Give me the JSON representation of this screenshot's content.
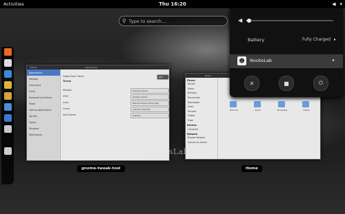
{
  "topbar": {
    "activities": "Activities",
    "clock": "Thu 16:20",
    "indicator_icons": [
      "volume-icon",
      "user-menu-chevron"
    ]
  },
  "search": {
    "placeholder": "Type to search..."
  },
  "dash": {
    "apps": [
      {
        "name": "firefox-icon",
        "color": "#e66a1f"
      },
      {
        "name": "mail-icon",
        "color": "#dddddd"
      },
      {
        "name": "internet-icon",
        "color": "#3b8ad8"
      },
      {
        "name": "rhythmbox-icon",
        "color": "#e1b23a"
      },
      {
        "name": "shotwell-icon",
        "color": "#d8a040"
      },
      {
        "name": "document-icon",
        "color": "#4a8ed8"
      },
      {
        "name": "software-icon",
        "color": "#3a7ad2"
      },
      {
        "name": "help-icon",
        "color": "#c8c8c8"
      },
      {
        "name": "show-apps-icon",
        "color": "#cccccc"
      }
    ]
  },
  "windows": {
    "tweak": {
      "label": "gnome-tweak-tool",
      "titlebar": [
        "Theme",
        "Appearance"
      ],
      "sidebar": [
        "Appearance",
        "Desktop",
        "Extensions",
        "Fonts",
        "Keyboard and Mouse",
        "Power",
        "Startup Applications",
        "Top Bar",
        "Typing",
        "Windows",
        "Workspaces"
      ],
      "rows": [
        {
          "label": "Global Dark Theme",
          "value": "OFF"
        },
        {
          "label": "Theme",
          "value": ""
        },
        {
          "label": "Window",
          "value": "Zukitwo-Hydra"
        },
        {
          "label": "GTK+",
          "value": "Zukitwo-Hydra"
        },
        {
          "label": "Icons",
          "value": "Faenza-Ubuntu-Dark-light"
        },
        {
          "label": "Cursor",
          "value": "Adwaita (default)"
        },
        {
          "label": "Shell theme",
          "value": "Adwaita"
        }
      ]
    },
    "files": {
      "label": "Home",
      "titlebar": [
        "Home"
      ],
      "places_header": "Places",
      "places": [
        "Recent",
        "Home",
        "Desktop",
        "Documents",
        "Downloads",
        "Music",
        "Pictures",
        "Videos",
        "Trash"
      ],
      "devices_header": "Devices",
      "devices": [
        "Computer"
      ],
      "network_header": "Network",
      "network": [
        "Browse Network",
        "Connect to Server"
      ],
      "folders": [
        "Desktop",
        "Documents",
        "Downloads",
        "Music",
        "Pictures",
        "Public",
        "Templates",
        "Videos"
      ]
    }
  },
  "menu": {
    "volume_level": 0.03,
    "battery_label": "Battery",
    "battery_status": "Fully Charged",
    "battery_arrow": "▸",
    "user_name": "NoobsLab",
    "user_arrow": "▸",
    "actions": [
      {
        "name": "settings-icon",
        "glyph": "✕"
      },
      {
        "name": "lock-icon",
        "glyph": "🔒"
      },
      {
        "name": "power-icon",
        "glyph": "⏻"
      }
    ]
  },
  "watermark": "NoobsLab.com"
}
